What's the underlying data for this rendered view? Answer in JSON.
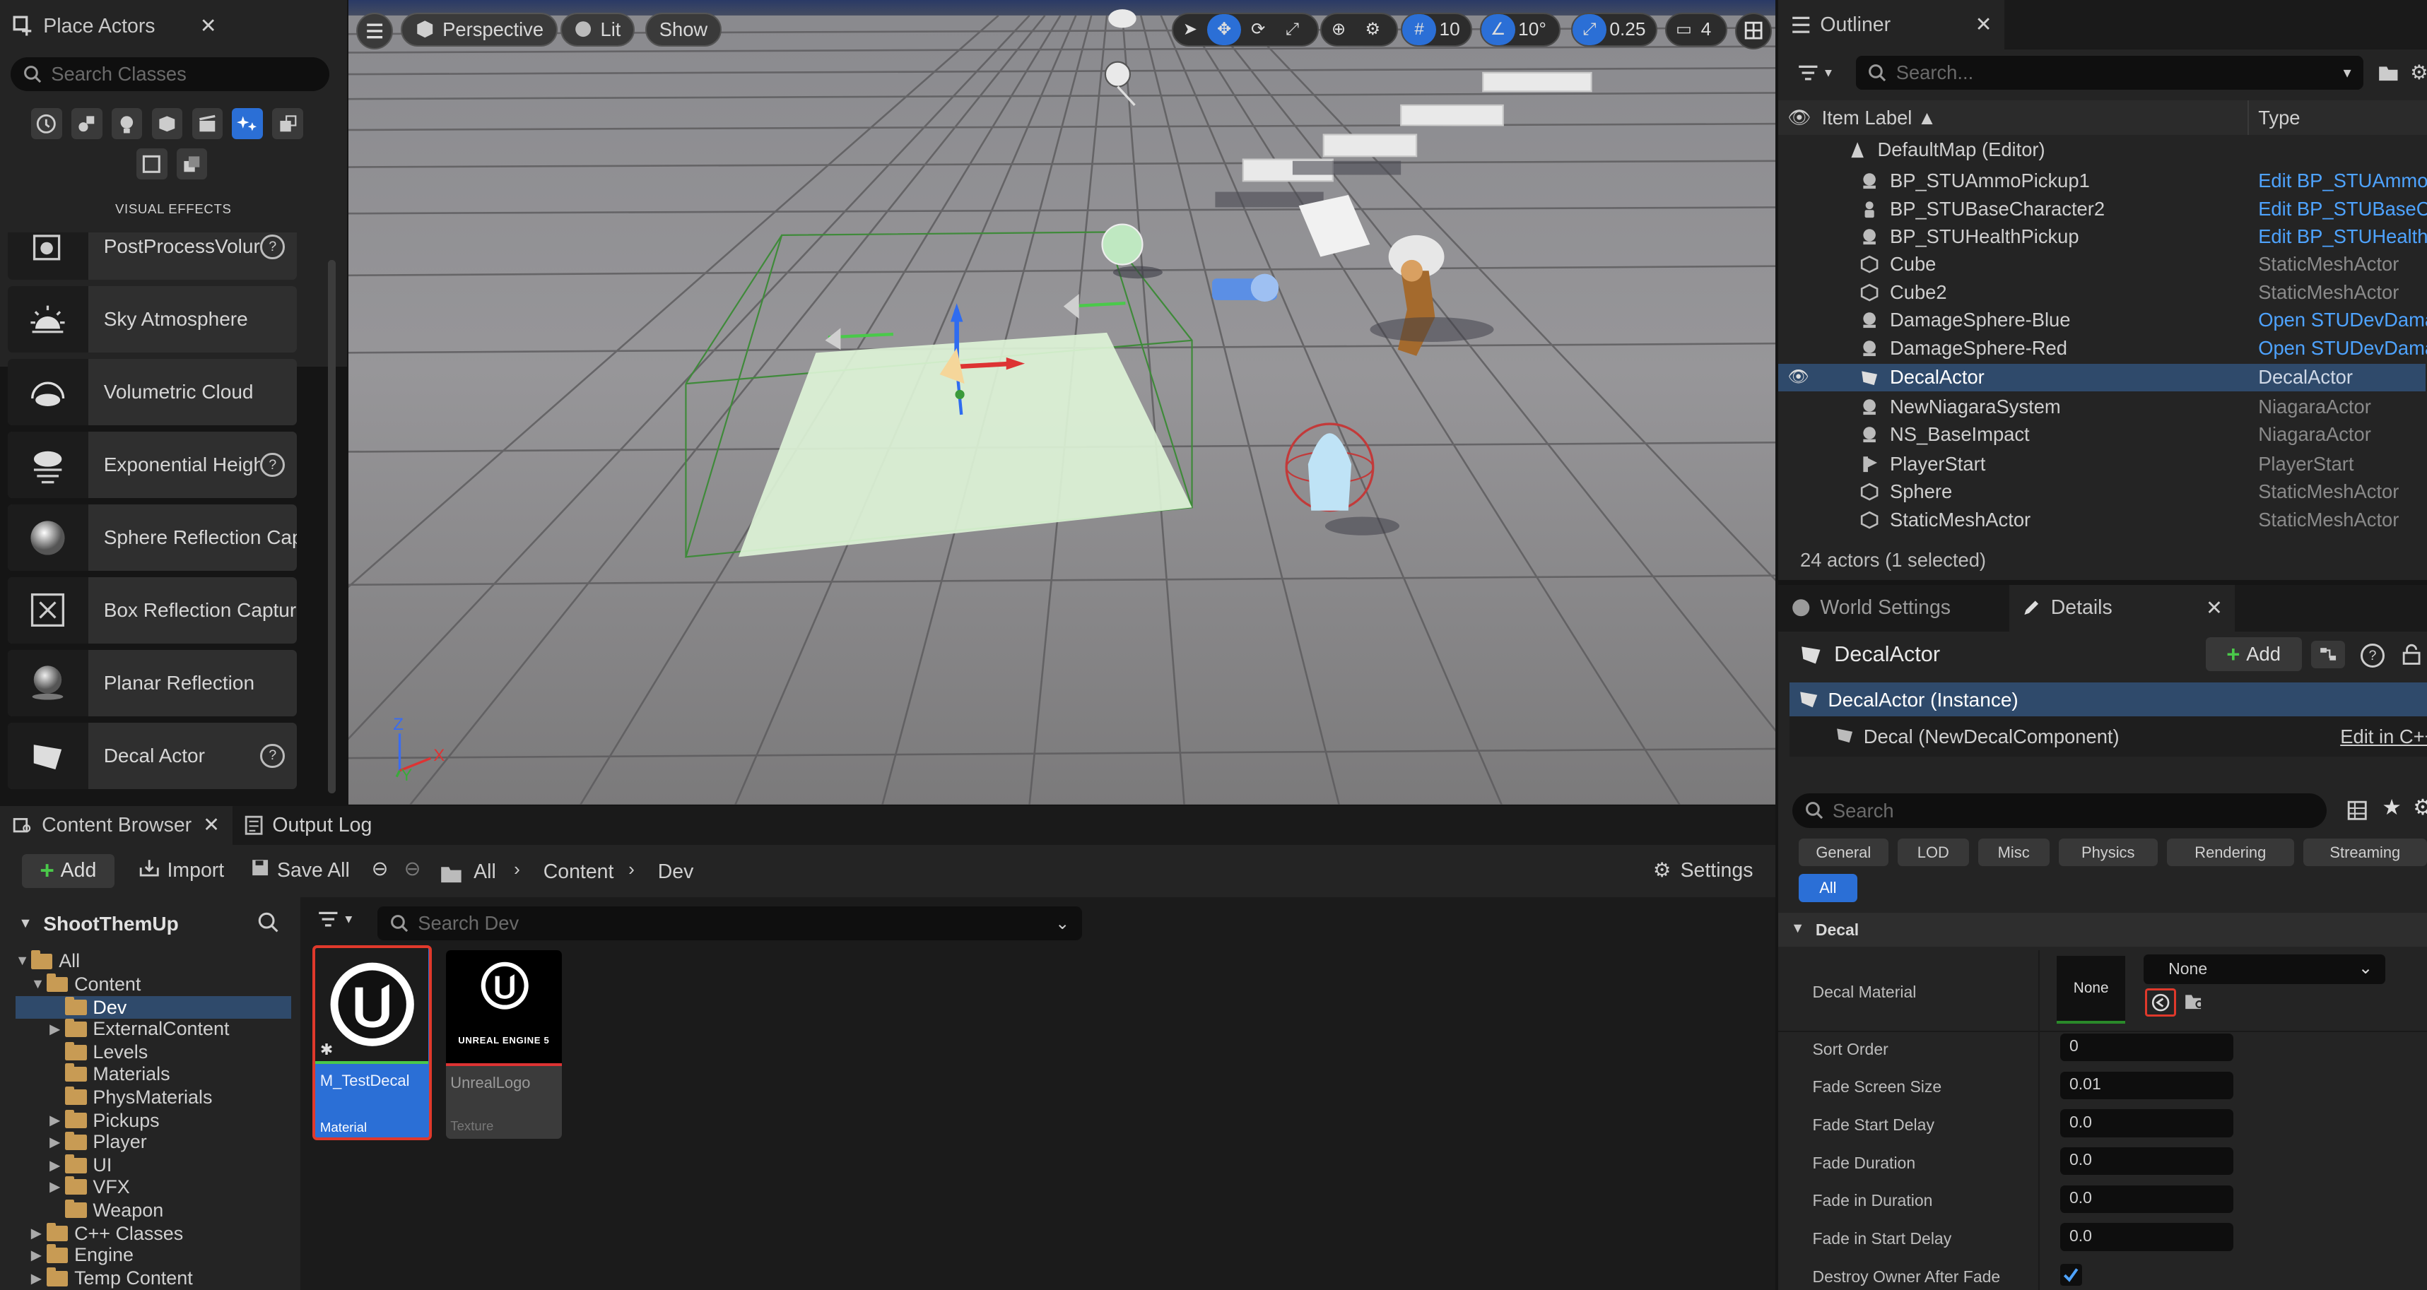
{
  "place_actors": {
    "tab_label": "Place Actors",
    "search_placeholder": "Search Classes",
    "category_label": "VISUAL EFFECTS",
    "items": [
      {
        "label": "PostProcessVolur",
        "icon": "post-process-icon",
        "help": true
      },
      {
        "label": "Sky Atmosphere",
        "icon": "sky-atmosphere-icon",
        "help": false
      },
      {
        "label": "Volumetric Cloud",
        "icon": "volumetric-cloud-icon",
        "help": false
      },
      {
        "label": "Exponential Heigh",
        "icon": "height-fog-icon",
        "help": true
      },
      {
        "label": "Sphere Reflection Capt",
        "icon": "sphere-reflection-icon",
        "help": false
      },
      {
        "label": "Box Reflection Capture",
        "icon": "box-reflection-icon",
        "help": false
      },
      {
        "label": "Planar Reflection",
        "icon": "planar-reflection-icon",
        "help": false
      },
      {
        "label": "Decal Actor",
        "icon": "decal-icon",
        "help": true
      }
    ]
  },
  "viewport": {
    "perspective_label": "Perspective",
    "lit_label": "Lit",
    "show_label": "Show",
    "grid_snap": "10",
    "rotation_snap": "10°",
    "scale_snap": "0.25",
    "camera_speed": "4",
    "axis_labels": {
      "z": "Z",
      "y": "Y",
      "x": "X"
    }
  },
  "outliner": {
    "tab_label": "Outliner",
    "search_placeholder": "Search...",
    "col_label": "Item Label ▲",
    "col_type": "Type",
    "root": "DefaultMap (Editor)",
    "rows": [
      {
        "name": "BP_STUAmmoPickup1",
        "type": "Edit BP_STUAmmo",
        "link": true,
        "icon": "actor-icon"
      },
      {
        "name": "BP_STUBaseCharacter2",
        "type": "Edit BP_STUBaseC",
        "link": true,
        "icon": "character-icon"
      },
      {
        "name": "BP_STUHealthPickup",
        "type": "Edit BP_STUHealth",
        "link": true,
        "icon": "actor-icon"
      },
      {
        "name": "Cube",
        "type": "StaticMeshActor",
        "link": false,
        "icon": "static-mesh-icon"
      },
      {
        "name": "Cube2",
        "type": "StaticMeshActor",
        "link": false,
        "icon": "static-mesh-icon"
      },
      {
        "name": "DamageSphere-Blue",
        "type": "Open STUDevDama",
        "link": true,
        "icon": "actor-icon"
      },
      {
        "name": "DamageSphere-Red",
        "type": "Open STUDevDama",
        "link": true,
        "icon": "actor-icon"
      },
      {
        "name": "DecalActor",
        "type": "DecalActor",
        "link": false,
        "icon": "decal-icon",
        "selected": true
      },
      {
        "name": "NewNiagaraSystem",
        "type": "NiagaraActor",
        "link": false,
        "icon": "actor-icon"
      },
      {
        "name": "NS_BaseImpact",
        "type": "NiagaraActor",
        "link": false,
        "icon": "actor-icon"
      },
      {
        "name": "PlayerStart",
        "type": "PlayerStart",
        "link": false,
        "icon": "player-start-icon"
      },
      {
        "name": "Sphere",
        "type": "StaticMeshActor",
        "link": false,
        "icon": "static-mesh-icon"
      },
      {
        "name": "StaticMeshActor",
        "type": "StaticMeshActor",
        "link": false,
        "icon": "static-mesh-icon"
      }
    ],
    "status": "24 actors (1 selected)"
  },
  "details": {
    "world_settings_tab": "World Settings",
    "tab_label": "Details",
    "actor_name": "DecalActor",
    "add_label": "Add",
    "instance_label": "DecalActor (Instance)",
    "component_label": "Decal (NewDecalComponent)",
    "edit_cpp": "Edit in C++",
    "search_placeholder": "Search",
    "filters": [
      "General",
      "LOD",
      "Misc",
      "Physics",
      "Rendering",
      "Streaming"
    ],
    "filter_all": "All",
    "section": "Decal",
    "decal_material_label": "Decal Material",
    "material_thumb": "None",
    "material_value": "None",
    "props": [
      {
        "key": "Sort Order",
        "value": "0"
      },
      {
        "key": "Fade Screen Size",
        "value": "0.01"
      },
      {
        "key": "Fade Start Delay",
        "value": "0.0"
      },
      {
        "key": "Fade Duration",
        "value": "0.0"
      },
      {
        "key": "Fade in Duration",
        "value": "0.0"
      },
      {
        "key": "Fade in Start Delay",
        "value": "0.0"
      }
    ],
    "destroy_owner_label": "Destroy Owner After Fade",
    "destroy_owner_checked": true
  },
  "content_browser": {
    "tab_label": "Content Browser",
    "output_log_tab": "Output Log",
    "add_label": "Add",
    "import_label": "Import",
    "save_all_label": "Save All",
    "path": [
      "All",
      "Content",
      "Dev"
    ],
    "settings_label": "Settings",
    "tree_root": "ShootThemUp",
    "search_placeholder": "Search Dev",
    "tree": [
      {
        "label": "All",
        "depth": 0,
        "caret": "▼"
      },
      {
        "label": "Content",
        "depth": 1,
        "caret": "▼"
      },
      {
        "label": "Dev",
        "depth": 2,
        "caret": "",
        "selected": true
      },
      {
        "label": "ExternalContent",
        "depth": 2,
        "caret": "▶"
      },
      {
        "label": "Levels",
        "depth": 2,
        "caret": ""
      },
      {
        "label": "Materials",
        "depth": 2,
        "caret": ""
      },
      {
        "label": "PhysMaterials",
        "depth": 2,
        "caret": ""
      },
      {
        "label": "Pickups",
        "depth": 2,
        "caret": "▶"
      },
      {
        "label": "Player",
        "depth": 2,
        "caret": "▶"
      },
      {
        "label": "UI",
        "depth": 2,
        "caret": "▶"
      },
      {
        "label": "VFX",
        "depth": 2,
        "caret": "▶"
      },
      {
        "label": "Weapon",
        "depth": 2,
        "caret": ""
      },
      {
        "label": "C++ Classes",
        "depth": 1,
        "caret": "▶"
      },
      {
        "label": "Engine",
        "depth": 1,
        "caret": "▶"
      },
      {
        "label": "Temp Content",
        "depth": 1,
        "caret": "▶"
      }
    ],
    "assets": [
      {
        "name": "M_TestDecal",
        "type": "Material",
        "selected": true
      },
      {
        "name": "UnrealLogo",
        "type": "Texture",
        "selected": false,
        "logo_text": "UNREAL ENGINE 5"
      }
    ]
  },
  "colors": {
    "accent_blue": "#2b6fd6",
    "selection_row": "#2f4a6b",
    "link_blue": "#4ea3ff",
    "folder": "#c89b54",
    "highlight_red": "#e0392b"
  }
}
